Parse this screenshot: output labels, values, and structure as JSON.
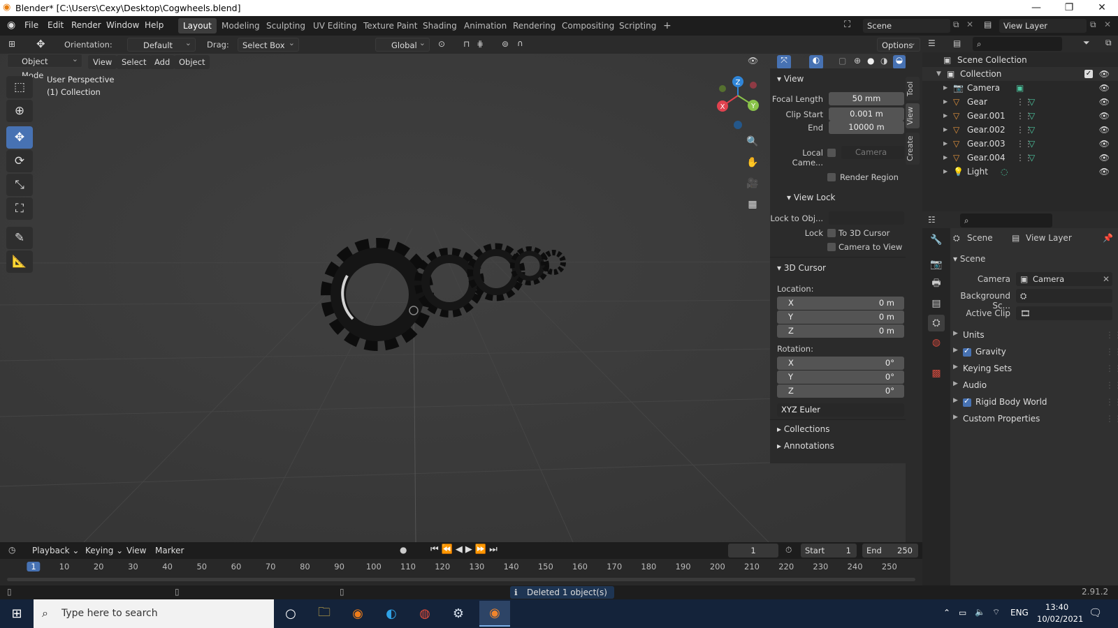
{
  "titlebar": {
    "title": "Blender* [C:\\Users\\Cexy\\Desktop\\Cogwheels.blend]",
    "minimize": "—",
    "restore": "❐",
    "close": "✕"
  },
  "menu": {
    "file": "File",
    "edit": "Edit",
    "render": "Render",
    "window": "Window",
    "help": "Help"
  },
  "workspaces": [
    "Layout",
    "Modeling",
    "Sculpting",
    "UV Editing",
    "Texture Paint",
    "Shading",
    "Animation",
    "Rendering",
    "Compositing",
    "Scripting"
  ],
  "add_workspace": "+",
  "scene_field": "Scene",
  "view_layer_field": "View Layer",
  "header": {
    "orientation_label": "Orientation:",
    "orientation_value": "Default",
    "drag_label": "Drag:",
    "drag_value": "Select Box",
    "transform_orientation": "Global",
    "options": "Options"
  },
  "viewport": {
    "mode": "Object Mode",
    "view": "View",
    "select": "Select",
    "add": "Add",
    "object": "Object",
    "perspective": "User Perspective",
    "collection": "(1) Collection",
    "gizmo": {
      "x": "X",
      "y": "Y",
      "z": "Z"
    }
  },
  "npanel": {
    "tabs": [
      "Tool",
      "View",
      "Create"
    ],
    "view_header": "View",
    "focal_length_label": "Focal Length",
    "focal_length": "50 mm",
    "clip_start_label": "Clip Start",
    "clip_start": "0.001 m",
    "end_label": "End",
    "clip_end": "10000 m",
    "local_camera_label": "Local Came...",
    "local_camera_value": "Camera",
    "render_region": "Render Region",
    "view_lock_header": "View Lock",
    "lock_to_obj_label": "Lock to Obj...",
    "lock_label": "Lock",
    "to_3d_cursor": "To 3D Cursor",
    "camera_to_view": "Camera to View",
    "cursor_header": "3D Cursor",
    "location_label": "Location:",
    "loc": [
      {
        "axis": "X",
        "value": "0 m"
      },
      {
        "axis": "Y",
        "value": "0 m"
      },
      {
        "axis": "Z",
        "value": "0 m"
      }
    ],
    "rotation_label": "Rotation:",
    "rot": [
      {
        "axis": "X",
        "value": "0°"
      },
      {
        "axis": "Y",
        "value": "0°"
      },
      {
        "axis": "Z",
        "value": "0°"
      }
    ],
    "rotation_mode": "XYZ Euler",
    "collections": "Collections",
    "annotations": "Annotations"
  },
  "outliner": {
    "scene_collection": "Scene Collection",
    "collection": "Collection",
    "items": [
      {
        "name": "Camera",
        "type": "camera"
      },
      {
        "name": "Gear",
        "type": "mesh"
      },
      {
        "name": "Gear.001",
        "type": "mesh"
      },
      {
        "name": "Gear.002",
        "type": "mesh"
      },
      {
        "name": "Gear.003",
        "type": "mesh"
      },
      {
        "name": "Gear.004",
        "type": "mesh"
      },
      {
        "name": "Light",
        "type": "light"
      }
    ]
  },
  "properties": {
    "breadcrumb_scene": "Scene",
    "breadcrumb_view_layer": "View Layer",
    "scene_header": "Scene",
    "camera_label": "Camera",
    "camera_value": "Camera",
    "background_label": "Background Sc...",
    "active_clip_label": "Active Clip",
    "sections": [
      {
        "name": "Units",
        "checkbox": false
      },
      {
        "name": "Gravity",
        "checkbox": true
      },
      {
        "name": "Keying Sets",
        "checkbox": false
      },
      {
        "name": "Audio",
        "checkbox": false
      },
      {
        "name": "Rigid Body World",
        "checkbox": true
      },
      {
        "name": "Custom Properties",
        "checkbox": false
      }
    ]
  },
  "timeline": {
    "playback": "Playback",
    "keying": "Keying",
    "view": "View",
    "marker": "Marker",
    "current_frame": "1",
    "start_label": "Start",
    "start": "1",
    "end_label": "End",
    "end": "250",
    "frames": [
      "1",
      "10",
      "20",
      "30",
      "40",
      "50",
      "60",
      "70",
      "80",
      "90",
      "100",
      "110",
      "120",
      "130",
      "140",
      "150",
      "160",
      "170",
      "180",
      "190",
      "200",
      "210",
      "220",
      "230",
      "240",
      "250"
    ]
  },
  "status": {
    "message": "Deleted 1 object(s)",
    "version": "2.91.2"
  },
  "taskbar": {
    "search_placeholder": "Type here to search",
    "language": "ENG",
    "time": "13:40",
    "date": "10/02/2021"
  },
  "colors": {
    "accent": "#4772b3",
    "axis_x": "#e0424f",
    "axis_y": "#8ac34a",
    "axis_z": "#2f85d8",
    "mesh_icon": "#e2923c"
  }
}
